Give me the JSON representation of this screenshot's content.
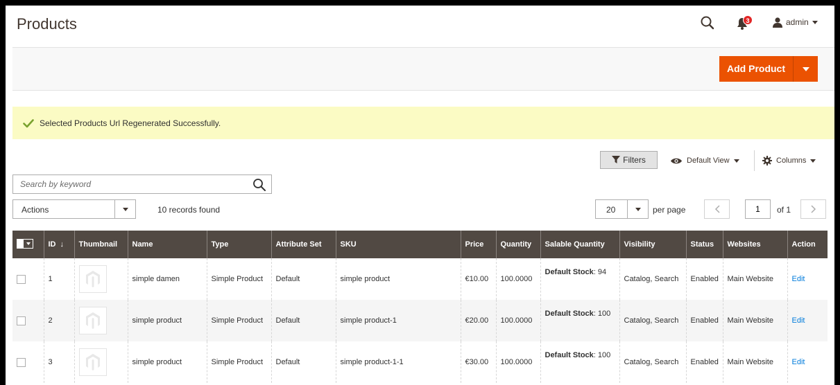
{
  "header": {
    "title": "Products",
    "notifications_count": "3",
    "user": "admin"
  },
  "action_bar": {
    "add_product_label": "Add Product"
  },
  "message": {
    "text": "Selected Products Url Regenerated Successfully."
  },
  "toolbar": {
    "filters_label": "Filters",
    "view_label": "Default View",
    "columns_label": "Columns",
    "search_placeholder": "Search by keyword",
    "actions_label": "Actions",
    "records_found": "10 records found",
    "per_page_value": "20",
    "per_page_label": "per page",
    "current_page": "1",
    "of_pages": "of 1"
  },
  "grid": {
    "columns": [
      "ID",
      "Thumbnail",
      "Name",
      "Type",
      "Attribute Set",
      "SKU",
      "Price",
      "Quantity",
      "Salable Quantity",
      "Visibility",
      "Status",
      "Websites",
      "Action"
    ],
    "sort_indicator": "↓",
    "rows": [
      {
        "id": "1",
        "name": "simple damen",
        "type": "Simple Product",
        "attribute_set": "Default",
        "sku": "simple product",
        "price": "€10.00",
        "quantity": "100.0000",
        "stock_label": "Default Stock",
        "stock_value": ": 94",
        "visibility": "Catalog, Search",
        "status": "Enabled",
        "websites": "Main Website",
        "action": "Edit"
      },
      {
        "id": "2",
        "name": "simple product",
        "type": "Simple Product",
        "attribute_set": "Default",
        "sku": "simple product-1",
        "price": "€20.00",
        "quantity": "100.0000",
        "stock_label": "Default Stock",
        "stock_value": ": 100",
        "visibility": "Catalog, Search",
        "status": "Enabled",
        "websites": "Main Website",
        "action": "Edit"
      },
      {
        "id": "3",
        "name": "simple product",
        "type": "Simple Product",
        "attribute_set": "Default",
        "sku": "simple product-1-1",
        "price": "€30.00",
        "quantity": "100.0000",
        "stock_label": "Default Stock",
        "stock_value": ": 100",
        "visibility": "Catalog, Search",
        "status": "Enabled",
        "websites": "Main Website",
        "action": "Edit"
      }
    ]
  },
  "colors": {
    "accent": "#eb5202",
    "grid_header": "#514943",
    "message_bg": "#fbfbc4",
    "success": "#79a22e",
    "link": "#007bdb"
  },
  "icons": {
    "search": "search-icon",
    "bell": "bell-icon",
    "user": "user-icon",
    "check": "check-icon",
    "filter": "funnel-icon",
    "eye": "eye-icon",
    "gear": "gear-icon",
    "thumbnail": "magento-logo-icon"
  }
}
